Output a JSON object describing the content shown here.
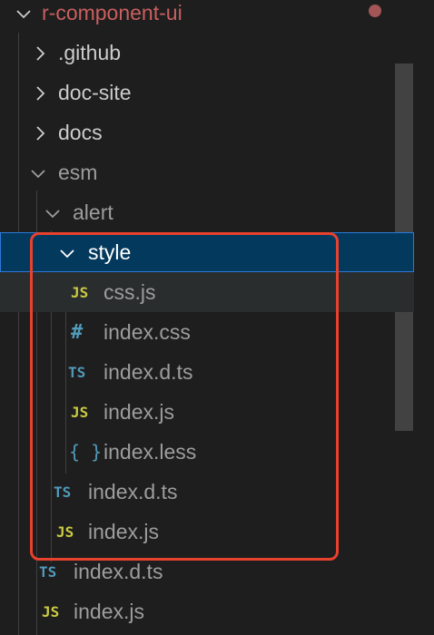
{
  "explorer": {
    "root": {
      "label": "r-component-ui",
      "expanded": true,
      "modified_dot_color": "#a45557"
    },
    "items": [
      {
        "label": ".github",
        "type": "folder",
        "expanded": false
      },
      {
        "label": "doc-site",
        "type": "folder",
        "expanded": false
      },
      {
        "label": "docs",
        "type": "folder",
        "expanded": false
      },
      {
        "label": "esm",
        "type": "folder",
        "expanded": true
      },
      {
        "label": "alert",
        "type": "folder",
        "expanded": true
      },
      {
        "label": "style",
        "type": "folder",
        "expanded": true,
        "selected": true
      },
      {
        "label": "css.js",
        "type": "file",
        "icon": "JS"
      },
      {
        "label": "index.css",
        "type": "file",
        "icon": "#"
      },
      {
        "label": "index.d.ts",
        "type": "file",
        "icon": "TS"
      },
      {
        "label": "index.js",
        "type": "file",
        "icon": "JS"
      },
      {
        "label": "index.less",
        "type": "file",
        "icon": "{ }"
      },
      {
        "label": "index.d.ts",
        "type": "file",
        "icon": "TS"
      },
      {
        "label": "index.js",
        "type": "file",
        "icon": "JS"
      },
      {
        "label": "index.d.ts",
        "type": "file",
        "icon": "TS"
      },
      {
        "label": "index.js",
        "type": "file",
        "icon": "JS"
      }
    ]
  },
  "colors": {
    "background": "#1e1e1e",
    "selection": "#04395e",
    "highlight_box": "#e8412d",
    "js_icon": "#cbcb41",
    "ts_icon": "#519aba"
  }
}
